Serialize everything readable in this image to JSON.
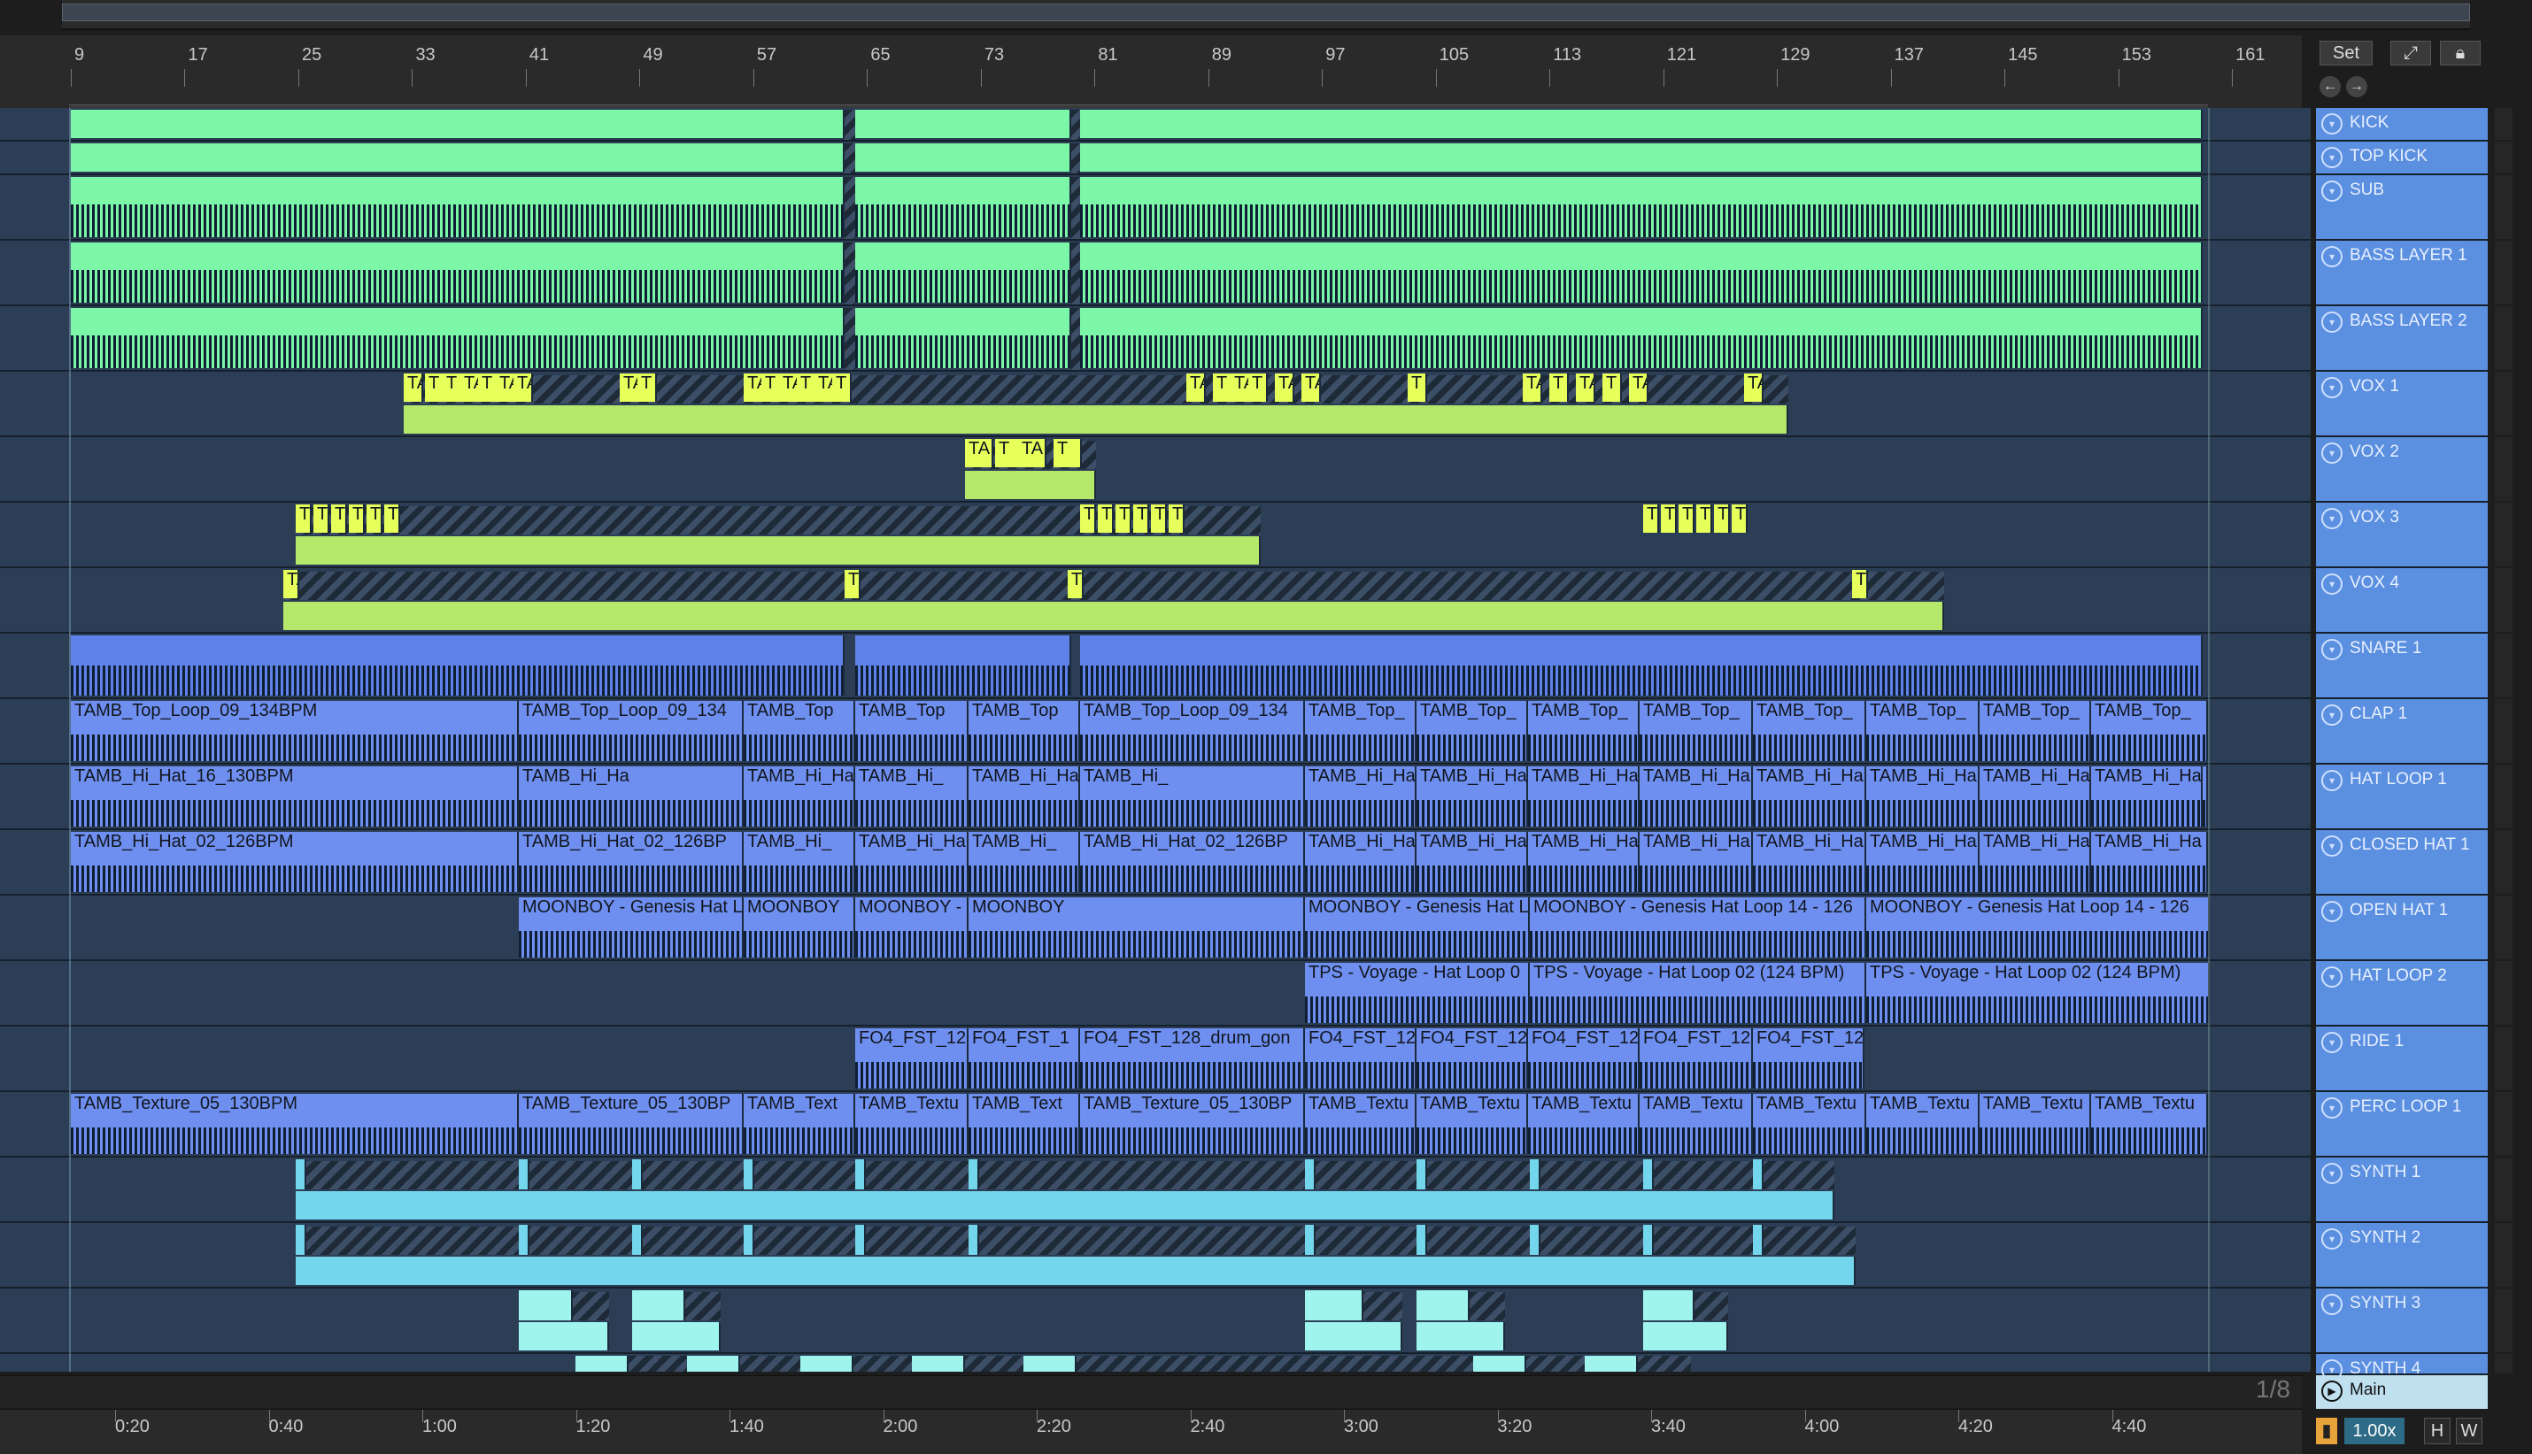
{
  "bar_markers": [
    "9",
    "17",
    "25",
    "33",
    "41",
    "49",
    "57",
    "65",
    "73",
    "81",
    "89",
    "97",
    "105",
    "113",
    "121",
    "129",
    "137",
    "145",
    "153",
    "161"
  ],
  "time_markers": [
    "0:20",
    "0:40",
    "1:00",
    "1:20",
    "1:40",
    "2:00",
    "2:20",
    "2:40",
    "3:00",
    "3:20",
    "3:40",
    "4:00",
    "4:20",
    "4:40"
  ],
  "controls": {
    "set_label": "Set",
    "zoom_fraction": "1/8",
    "main_track": "Main",
    "tempo_factor": "1.00x",
    "h_label": "H",
    "w_label": "W"
  },
  "tracks": [
    {
      "name": "KICK",
      "color": "#7cf7a8"
    },
    {
      "name": "TOP KICK",
      "color": "#7cf7a8"
    },
    {
      "name": "SUB",
      "color": "#7cf7a8"
    },
    {
      "name": "BASS LAYER 1",
      "color": "#7cf7a8"
    },
    {
      "name": "BASS LAYER 2",
      "color": "#7cf7a8"
    },
    {
      "name": "VOX 1",
      "color": "#c7f15f"
    },
    {
      "name": "VOX 2",
      "color": "#c7f15f"
    },
    {
      "name": "VOX 3",
      "color": "#c7f15f"
    },
    {
      "name": "VOX 4",
      "color": "#c7f15f"
    },
    {
      "name": "SNARE 1",
      "color": "#6f8ff0"
    },
    {
      "name": "CLAP 1",
      "color": "#6f8ff0"
    },
    {
      "name": "HAT LOOP 1",
      "color": "#6f8ff0"
    },
    {
      "name": "CLOSED HAT 1",
      "color": "#6f8ff0"
    },
    {
      "name": "OPEN HAT 1",
      "color": "#6f8ff0"
    },
    {
      "name": "HAT LOOP 2",
      "color": "#6f8ff0"
    },
    {
      "name": "RIDE 1",
      "color": "#6f8ff0"
    },
    {
      "name": "PERC LOOP 1",
      "color": "#6f8ff0"
    },
    {
      "name": "SYNTH 1",
      "color": "#74d6ec"
    },
    {
      "name": "SYNTH 2",
      "color": "#74d6ec"
    },
    {
      "name": "SYNTH 3",
      "color": "#7ef0e4"
    },
    {
      "name": "SYNTH 4",
      "color": "#7ef0e4"
    }
  ],
  "clips": {
    "vox1": [
      "TA",
      "T",
      "T",
      "TA",
      "T",
      "TA",
      "TA",
      "TA",
      "T",
      "TA",
      "T",
      "TA",
      "T",
      "TA",
      "T",
      "TA",
      "T",
      "TA",
      "T",
      "TA",
      "TA",
      "T",
      "TA",
      "T",
      "TA",
      "T",
      "TA",
      "TA"
    ],
    "vox2": [
      "TA",
      "T",
      "TA",
      "T"
    ],
    "vox3": [
      "T",
      "T",
      "T",
      "T",
      "T",
      "T",
      "T",
      "T",
      "T",
      "T",
      "T",
      "T",
      "T",
      "T",
      "T",
      "T",
      "T",
      "T",
      "T",
      "T"
    ],
    "vox4": [
      "TA",
      "T",
      "T",
      "T"
    ],
    "clap": [
      "TAMB_Top_Loop_09_134BPM",
      "TAMB_Top_Loop_09_134",
      "TAMB_Top",
      "TAMB_Top",
      "TAMB_Top",
      "TAMB_Top_Loop_09_134",
      "TAMB_Top_",
      "TAMB_Top_",
      "TAMB_Top_",
      "TAMB_Top_",
      "TAMB_Top_",
      "TAMB_Top_",
      "TAMB_Top_",
      "TAMB_Top_"
    ],
    "hat1": [
      "TAMB_Hi_Hat_16_130BPM",
      "TAMB_Hi_Ha",
      "TAMB_Hi_Ha",
      "TAMB_Hi_",
      "TAMB_Hi_Ha",
      "TAMB_Hi_",
      "TAMB_Hi_Hat_16_130BP",
      "TAMB_Hi_Ha",
      "TAMB_Hi_Ha",
      "TAMB_Hi_Ha",
      "TAMB_Hi_Ha",
      "TAMB_Hi_Ha",
      "TAMB_Hi_Ha",
      "TAMB_Hi_Ha",
      "TAMB_Hi_Ha"
    ],
    "closed": [
      "TAMB_Hi_Hat_02_126BPM",
      "TAMB_Hi_Hat_02_126BP",
      "TAMB_Hi_",
      "TAMB_Hi_Ha",
      "TAMB_Hi_",
      "TAMB_Hi_Hat_02_126BP",
      "TAMB_Hi_Ha",
      "TAMB_Hi_Ha",
      "TAMB_Hi_Ha",
      "TAMB_Hi_Ha",
      "TAMB_Hi_Ha",
      "TAMB_Hi_Ha",
      "TAMB_Hi_Ha",
      "TAMB_Hi_Ha"
    ],
    "open": [
      "MOONBOY - Genesis Hat L",
      "MOONBOY",
      "MOONBOY -",
      "MOONBOY",
      "MOONBOY - Genesis Hat L",
      "MOONBOY - Genesis Hat Loop 14 - 126",
      "MOONBOY - Genesis Hat Loop 14 - 126"
    ],
    "hat2": [
      "TPS - Voyage - Hat Loop 0",
      "TPS - Voyage - Hat Loop 02 (124 BPM)",
      "TPS - Voyage - Hat Loop 02 (124 BPM)"
    ],
    "ride": [
      "FO4_FST_12",
      "FO4_FST_1",
      "FO4_FST_128_drum_gon",
      "FO4_FST_12",
      "FO4_FST_12",
      "FO4_FST_12",
      "FO4_FST_12",
      "FO4_FST_12"
    ],
    "perc": [
      "TAMB_Texture_05_130BPM",
      "TAMB_Texture_05_130BP",
      "TAMB_Text",
      "TAMB_Textu",
      "TAMB_Text",
      "TAMB_Texture_05_130BP",
      "TAMB_Textu",
      "TAMB_Textu",
      "TAMB_Textu",
      "TAMB_Textu",
      "TAMB_Textu",
      "TAMB_Textu",
      "TAMB_Textu",
      "TAMB_Textu"
    ]
  }
}
